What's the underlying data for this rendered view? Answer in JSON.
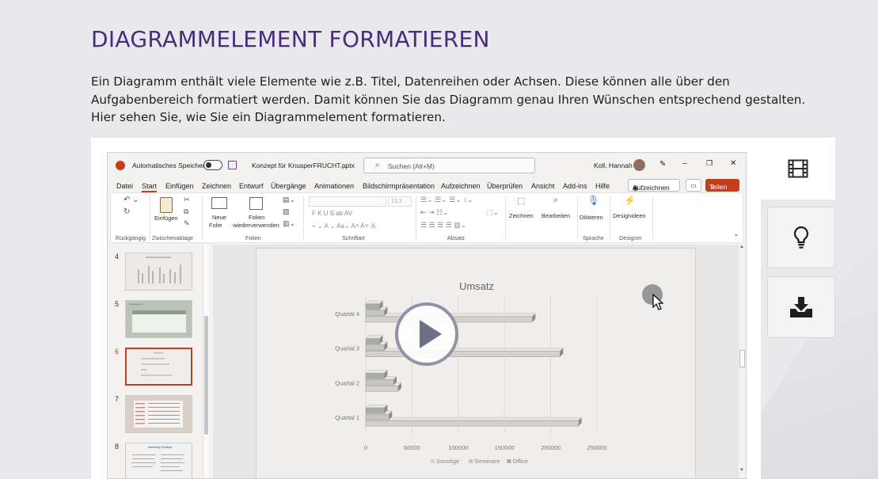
{
  "heading": "DIAGRAMMELEMENT FORMATIEREN",
  "intro": "Ein Diagramm enthält viele Elemente wie z.B. Titel, Datenreihen oder Achsen. Diese können alle über den Aufgabenbereich formatiert werden. Damit können Sie das Diagramm genau Ihren Wünschen entsprechend gestalten. Hier sehen Sie, wie Sie ein Diagrammelement formatieren.",
  "side_buttons": {
    "video_icon": "film-icon",
    "tip_icon": "lightbulb-icon",
    "download_icon": "download-icon"
  },
  "ppt": {
    "autosave_label": "Automatisches Speichern",
    "doc_name": "Konzept für KnusperFRUCHT.pptx",
    "search_placeholder": "Suchen (Alt+M)",
    "user": "Koll, Hannah",
    "menu": [
      "Datei",
      "Start",
      "Einfügen",
      "Zeichnen",
      "Entwurf",
      "Übergänge",
      "Animationen",
      "Bildschirmpräsentation",
      "Aufzeichnen",
      "Überprüfen",
      "Ansicht",
      "Add-ins",
      "Hilfe"
    ],
    "record_button": "Aufzeichnen",
    "share_button": "Teilen",
    "ribbon": {
      "einfuegen": "Einfügen",
      "neue_folie_1": "Neue",
      "neue_folie_2": "Folie",
      "folien_wv_1": "Folien",
      "folien_wv_2": "wiederverwenden",
      "font_size": "13,3",
      "font_buttons": "F  K  U  S  ab  AV",
      "zeichnen": "Zeichnen",
      "bearbeiten": "Bearbeiten",
      "diktieren": "Diktieren",
      "designideen": "Designideen",
      "groups": [
        "Rückgängig",
        "Zwischenablage",
        "Folien",
        "Schriftart",
        "Absatz",
        "Sprache",
        "Designer"
      ]
    },
    "thumbnails": [
      "4",
      "5",
      "6",
      "7",
      "8"
    ],
    "active_thumbnail": "6",
    "thumb8_title": "Marketing Strategie",
    "thumb5_title": "Organisation"
  },
  "chart_data": {
    "type": "bar",
    "orientation": "horizontal",
    "title": "Umsatz",
    "categories": [
      "Quartal 1",
      "Quartal 2",
      "Quartal 3",
      "Quartal 4"
    ],
    "series": [
      {
        "name": "Sonstige",
        "values": [
          230000,
          35000,
          210000,
          180000
        ],
        "color": "#d5d0cc"
      },
      {
        "name": "Seminare",
        "values": [
          25000,
          30000,
          20000,
          20000
        ],
        "color": "#c4c6c2"
      },
      {
        "name": "Office",
        "values": [
          20000,
          20000,
          15000,
          15000
        ],
        "color": "#a9aca8"
      }
    ],
    "xticks": [
      "0",
      "50000",
      "100000",
      "150000",
      "200000",
      "250000"
    ],
    "xlim": [
      0,
      250000
    ],
    "legend_position": "bottom",
    "grid": true
  }
}
